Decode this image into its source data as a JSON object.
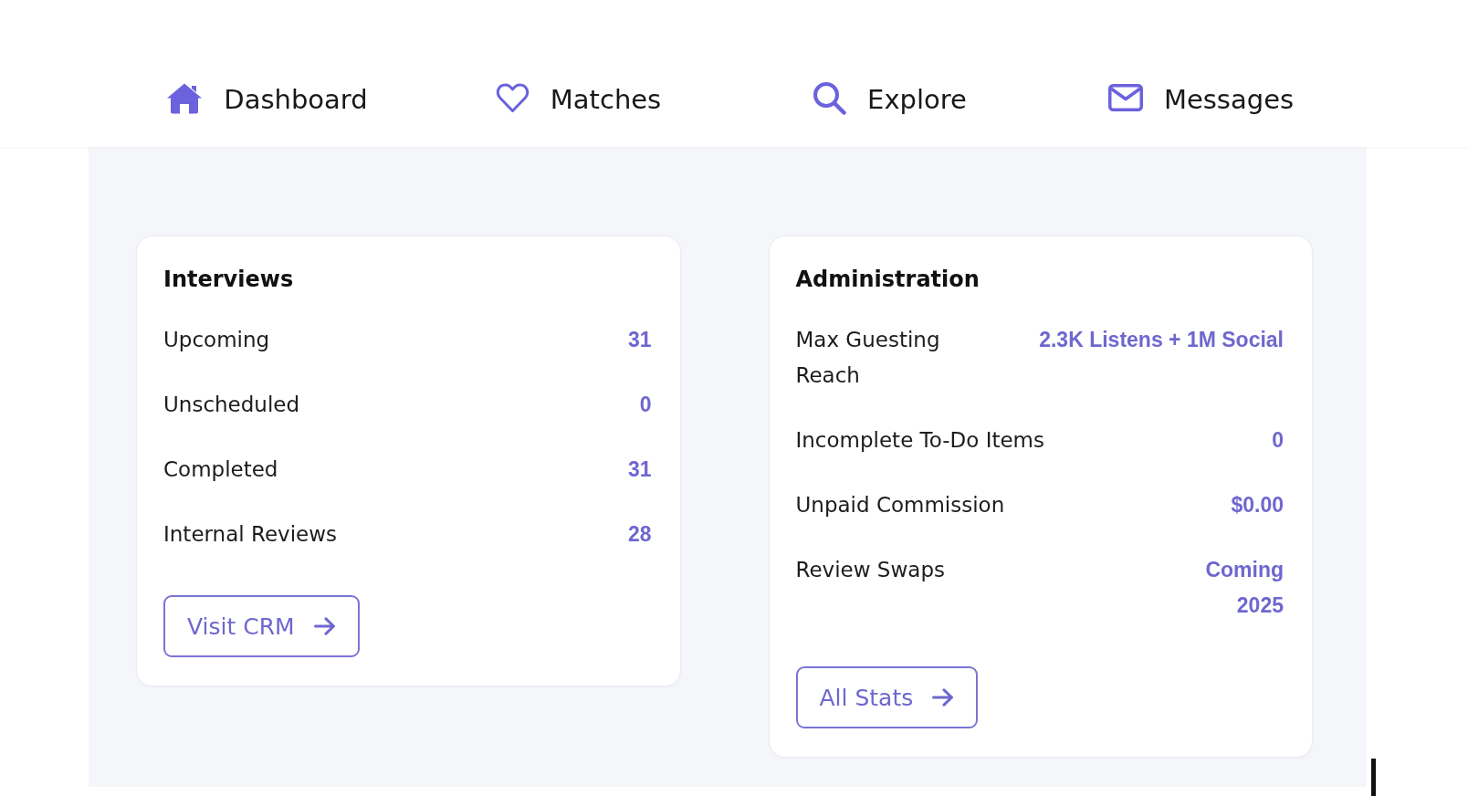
{
  "nav": {
    "items": [
      {
        "kind": "dashboard",
        "label": "Dashboard"
      },
      {
        "kind": "matches",
        "label": "Matches"
      },
      {
        "kind": "explore",
        "label": "Explore"
      },
      {
        "kind": "messages",
        "label": "Messages"
      }
    ]
  },
  "cards": [
    {
      "title": "Interviews",
      "rows": [
        {
          "label": "Upcoming",
          "value": "31"
        },
        {
          "label": "Unscheduled",
          "value": "0"
        },
        {
          "label": "Completed",
          "value": "31"
        },
        {
          "label": "Internal Reviews",
          "value": "28"
        }
      ],
      "button": {
        "label": "Visit CRM"
      }
    },
    {
      "title": "Administration",
      "rows": [
        {
          "label": "Max Guesting Reach",
          "value": "2.3K Listens + 1M Social"
        },
        {
          "label": "Incomplete To-Do Items",
          "value": "0"
        },
        {
          "label": "Unpaid Commission",
          "value": "$0.00"
        },
        {
          "label": "Review Swaps",
          "value": "Coming\n2025"
        }
      ],
      "button": {
        "label": "All Stats"
      }
    }
  ]
}
